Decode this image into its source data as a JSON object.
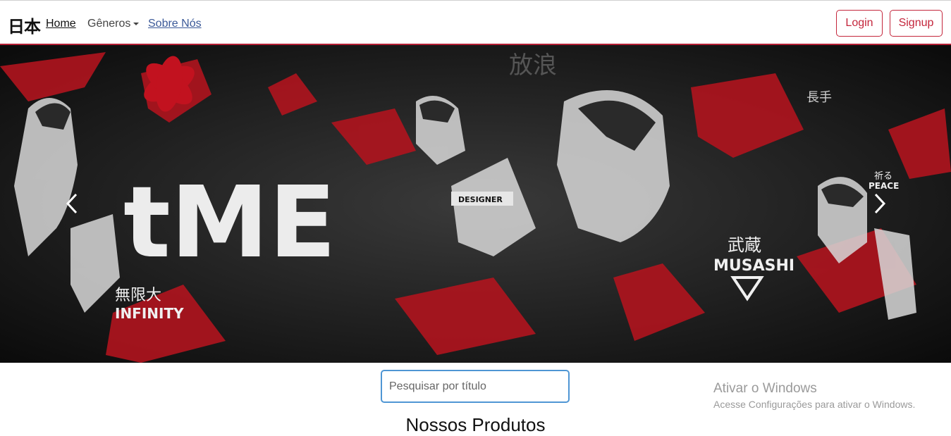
{
  "navbar": {
    "brand": "日本",
    "links": [
      {
        "label": "Home"
      },
      {
        "label": "Gêneros"
      },
      {
        "label": "Sobre Nós"
      }
    ],
    "login_label": "Login",
    "signup_label": "Signup"
  },
  "hero": {
    "big_text": "tME",
    "designer_label": "DESIGNER",
    "infinity_kanji": "無限大",
    "infinity_label": "INFINITY",
    "musashi_kanji": "武蔵",
    "musashi_label": "MUSASHI",
    "peace_kanji": "祈る",
    "peace_label": "PEACE",
    "top_kanji": "放浪",
    "right_kanji": "長手"
  },
  "search": {
    "placeholder": "Pesquisar por título"
  },
  "section": {
    "title": "Nossos Produtos"
  },
  "watermark": {
    "title": "Ativar o Windows",
    "subtitle": "Acesse Configurações para ativar o Windows."
  },
  "colors": {
    "accent": "#c4263c",
    "hero_red": "#b0141e"
  }
}
